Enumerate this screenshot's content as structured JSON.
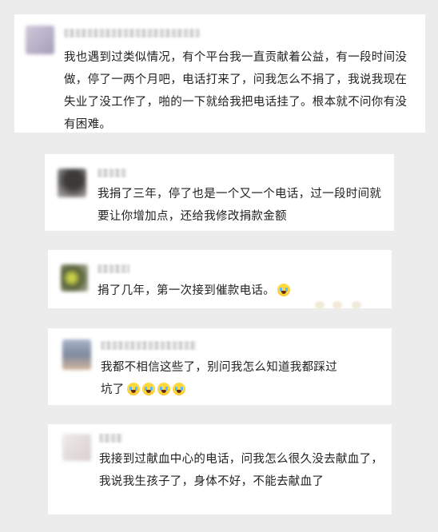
{
  "comments": [
    {
      "text": "我也遇到过类似情况，有个平台我一直贡献着公益，有一段时间没做，停了一两个月吧，电话打来了，问我怎么不捐了，我说我现在失业了没工作了，啪的一下就给我把电话挂了。根本就不问你有没有困难。",
      "avatar_color": "#b9b2c8",
      "emoji_count": 0
    },
    {
      "text": "我捐了三年，停了也是一个又一个电话，过一段时间就要让你增加点，还给我修改捐款金额",
      "avatar_color": "#6d6a68",
      "emoji_count": 0
    },
    {
      "text": "捐了几年，第一次接到催款电话。",
      "avatar_color": "#7a8a4a",
      "emoji_count": 1
    },
    {
      "text": "我都不相信这些了，别问我怎么知道我都踩过坑了",
      "avatar_color": "#8e9bb4",
      "emoji_count": 4
    },
    {
      "text": "我接到过献血中心的电话，问我怎么很久没去献血了，我说我生孩子了，身体不好，不能去献血了",
      "avatar_color": "#e6dede",
      "emoji_count": 0
    }
  ]
}
